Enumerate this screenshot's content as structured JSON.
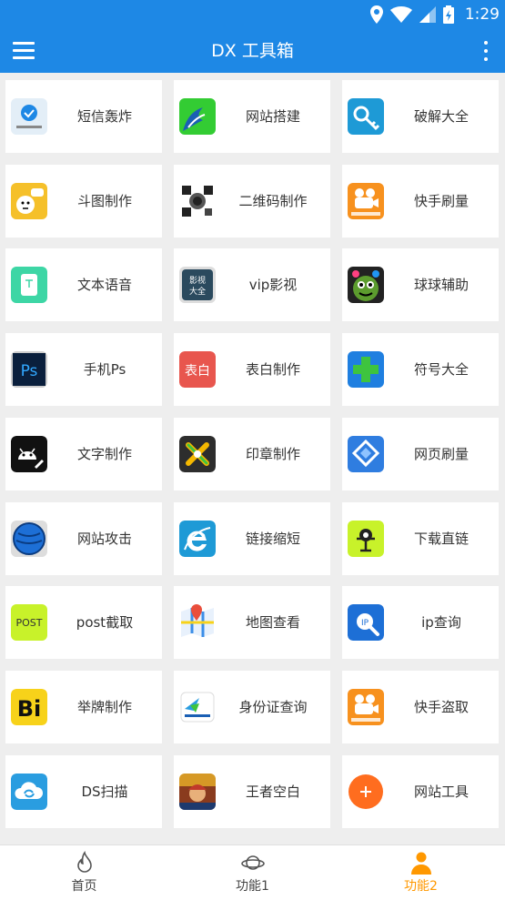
{
  "status_bar": {
    "time": "1:29"
  },
  "app_bar": {
    "title": "DX 工具箱"
  },
  "tools": [
    {
      "label": "短信轰炸",
      "icon": "sms-bomb-icon",
      "color": "#e3eef7"
    },
    {
      "label": "网站搭建",
      "icon": "wave-icon",
      "color": "#33cc33"
    },
    {
      "label": "破解大全",
      "icon": "key-icon",
      "color": "#1e9ad6"
    },
    {
      "label": "斗图制作",
      "icon": "meme-icon",
      "color": "#f5c02a"
    },
    {
      "label": "二维码制作",
      "icon": "qr-code-icon",
      "color": "#555555"
    },
    {
      "label": "快手刷量",
      "icon": "kuaishou-icon",
      "color": "#f7911e"
    },
    {
      "label": "文本语音",
      "icon": "text-speech-icon",
      "color": "#3dd6a5"
    },
    {
      "label": "vip影视",
      "icon": "movie-icon",
      "color": "#2b4a5e"
    },
    {
      "label": "球球辅助",
      "icon": "ball-game-icon",
      "color": "#5c9c2e"
    },
    {
      "label": "手机Ps",
      "icon": "photoshop-icon",
      "color": "#0a1f3c"
    },
    {
      "label": "表白制作",
      "icon": "love-note-icon",
      "color": "#e8564e"
    },
    {
      "label": "符号大全",
      "icon": "plus-symbol-icon",
      "color": "#1f7fe0"
    },
    {
      "label": "文字制作",
      "icon": "android-pen-icon",
      "color": "#111111"
    },
    {
      "label": "印章制作",
      "icon": "stamp-icon",
      "color": "#2d2d2d"
    },
    {
      "label": "网页刷量",
      "icon": "cube-icon",
      "color": "#2f7de0"
    },
    {
      "label": "网站攻击",
      "icon": "globe-icon",
      "color": "#1d6fd6"
    },
    {
      "label": "链接缩短",
      "icon": "ie-browser-icon",
      "color": "#1e9ad6"
    },
    {
      "label": "下载直链",
      "icon": "download-bot-icon",
      "color": "#c8f22a"
    },
    {
      "label": "post截取",
      "icon": "post-icon",
      "color": "#c8f22a"
    },
    {
      "label": "地图查看",
      "icon": "map-icon",
      "color": "#3b8ee8"
    },
    {
      "label": "ip查询",
      "icon": "ip-search-icon",
      "color": "#1d6fd6"
    },
    {
      "label": "举牌制作",
      "icon": "bi-sign-icon",
      "color": "#f7d21a"
    },
    {
      "label": "身份证查询",
      "icon": "id-card-icon",
      "color": "#2a9de0"
    },
    {
      "label": "快手盗取",
      "icon": "kuaishou-icon",
      "color": "#f7911e"
    },
    {
      "label": "DS扫描",
      "icon": "cloud-icon",
      "color": "#2a9de0"
    },
    {
      "label": "王者空白",
      "icon": "game-hero-icon",
      "color": "#8a3b1e"
    },
    {
      "label": "网站工具",
      "icon": "add-circle-icon",
      "color": "#ff6d1f"
    }
  ],
  "bottom_nav": [
    {
      "label": "首页",
      "icon": "flame-icon"
    },
    {
      "label": "功能1",
      "icon": "planet-icon"
    },
    {
      "label": "功能2",
      "icon": "person-icon",
      "active": true
    }
  ],
  "texts": {
    "post_icon_text": "POST",
    "bi_icon_text": "Bi",
    "ps_icon_text": "Ps",
    "love_icon_text": "表白",
    "vip_icon_text": "影视大全",
    "ip_icon_text": "IP"
  }
}
